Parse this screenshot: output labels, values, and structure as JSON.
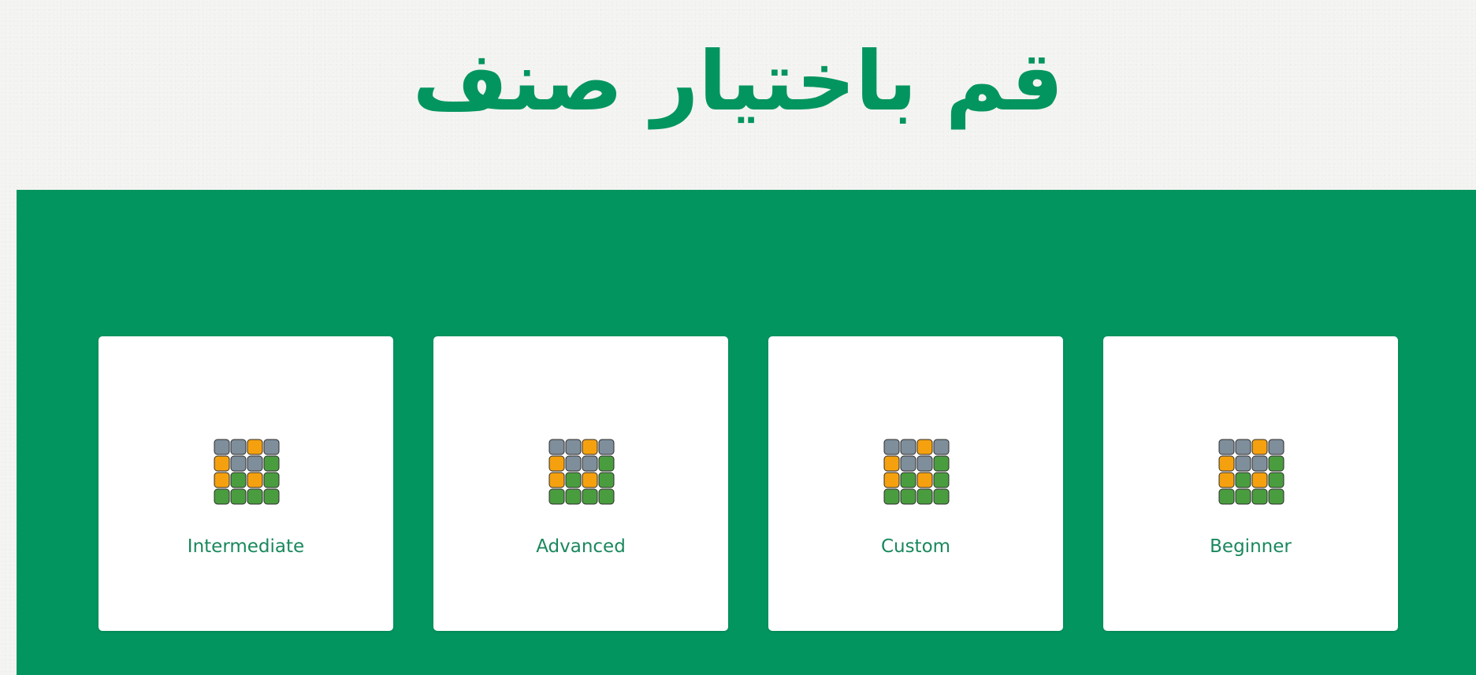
{
  "page": {
    "title": "قم باختيار صنف",
    "title_color": "#03955f",
    "panel_color": "#03955f"
  },
  "levels": [
    {
      "label": "Intermediate",
      "icon": "grid-tiles-icon",
      "grid": [
        [
          "gray",
          "gray",
          "orange",
          "gray"
        ],
        [
          "orange",
          "gray",
          "gray",
          "green"
        ],
        [
          "orange",
          "green",
          "orange",
          "green"
        ],
        [
          "green",
          "green",
          "green",
          "green"
        ]
      ]
    },
    {
      "label": "Advanced",
      "icon": "grid-tiles-icon",
      "grid": [
        [
          "gray",
          "gray",
          "orange",
          "gray"
        ],
        [
          "orange",
          "gray",
          "gray",
          "green"
        ],
        [
          "orange",
          "green",
          "orange",
          "green"
        ],
        [
          "green",
          "green",
          "green",
          "green"
        ]
      ]
    },
    {
      "label": "Custom",
      "icon": "grid-tiles-icon",
      "grid": [
        [
          "gray",
          "gray",
          "orange",
          "gray"
        ],
        [
          "orange",
          "gray",
          "gray",
          "green"
        ],
        [
          "orange",
          "green",
          "orange",
          "green"
        ],
        [
          "green",
          "green",
          "green",
          "green"
        ]
      ]
    },
    {
      "label": "Beginner",
      "icon": "grid-tiles-icon",
      "grid": [
        [
          "gray",
          "gray",
          "orange",
          "gray"
        ],
        [
          "orange",
          "gray",
          "gray",
          "green"
        ],
        [
          "orange",
          "green",
          "orange",
          "green"
        ],
        [
          "green",
          "green",
          "green",
          "green"
        ]
      ]
    }
  ],
  "tile_colors": {
    "gray": "#7f8e9b",
    "orange": "#f5a10f",
    "green": "#4a9d3f",
    "outline": "#2c2c2c"
  }
}
